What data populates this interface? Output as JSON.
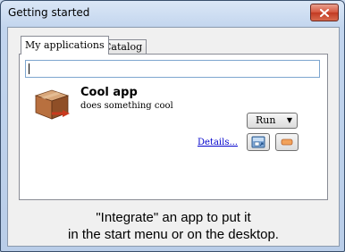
{
  "window": {
    "title": "Getting started",
    "close_icon": "close-icon"
  },
  "tabs": [
    {
      "label": "My applications",
      "active": true
    },
    {
      "label": "Catalog",
      "active": false
    }
  ],
  "search": {
    "value": "",
    "placeholder": ""
  },
  "app": {
    "name": "Cool app",
    "description": "does something cool",
    "icon": "package-box-icon",
    "details_link": "Details...",
    "run_label": "Run",
    "run_dropdown_icon": "chevron-down-icon",
    "integrate_icon": "integrate-icon",
    "remove_icon": "minus-icon"
  },
  "hint": {
    "line1": "\"Integrate\" an app to put it",
    "line2": "in the start menu or on the desktop."
  },
  "colors": {
    "link": "#0000cc",
    "close_button": "#c23a22",
    "search_border": "#7ea6cf"
  }
}
